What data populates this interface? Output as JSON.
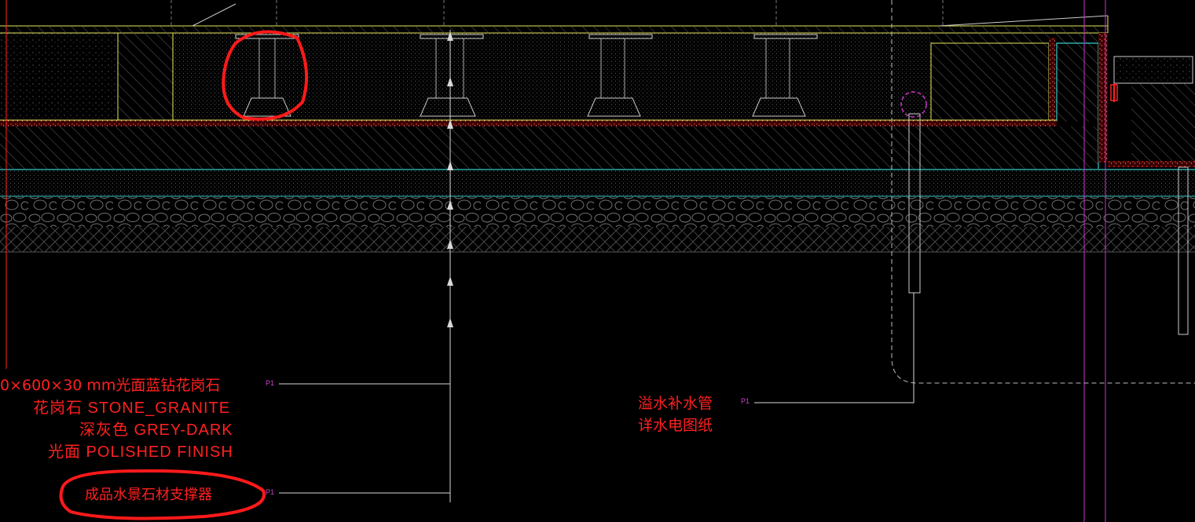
{
  "colors": {
    "background": "#000000",
    "annotation": "#ff2020",
    "hatch": "#6a6a6a",
    "slab_edge": "#e8e85a",
    "waterproof": "#ff3030",
    "cyan_line": "#33cccc",
    "magenta": "#cc33cc",
    "leader": "#d8d8d8",
    "tag": "#cc44cc",
    "redline": "#ff1a1a"
  },
  "annotations": {
    "left_note": {
      "line1": "0×600×30 mm光面蓝钻花岗石",
      "line2": "花岗石 STONE_GRANITE",
      "line3": "深灰色 GREY-DARK",
      "line4": "光面 POLISHED FINISH",
      "tag": "P1"
    },
    "support_note": {
      "text": "成品水景石材支撑器",
      "tag": "P1"
    },
    "pipe_note": {
      "line1": "溢水补水管",
      "line2": "详水电图纸",
      "tag": "P1"
    }
  },
  "icons": {
    "redline_cloud": "circle-markup-icon",
    "pipe": "pipe-section-icon",
    "pedestal": "pedestal-support-icon"
  }
}
